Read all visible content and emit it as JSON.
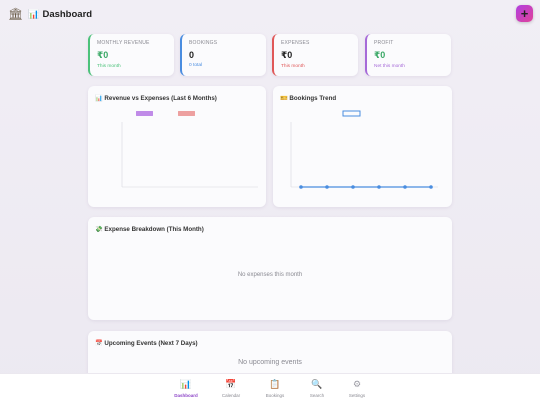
{
  "header": {
    "brand_icon": "bank-icon",
    "title_icon": "bar-chart-icon",
    "title": "Dashboard",
    "add_label": "+"
  },
  "stats": [
    {
      "label": "MONTHLY REVENUE",
      "value": "₹0",
      "sub": "This month",
      "color": "#4cc27a"
    },
    {
      "label": "BOOKINGS",
      "value": "0",
      "sub": "0 total",
      "color": "#4a8de0"
    },
    {
      "label": "EXPENSES",
      "value": "₹0",
      "sub": "This month",
      "color": "#e05858"
    },
    {
      "label": "PROFIT",
      "value": "₹0",
      "sub": "Net this month",
      "color": "#a66ad8"
    }
  ],
  "revenue_chart": {
    "title": "📊 Revenue vs Expenses (Last 6 Months)"
  },
  "bookings_chart": {
    "title": "🎫 Bookings Trend"
  },
  "breakdown": {
    "title": "💸 Expense Breakdown (This Month)",
    "empty": "No expenses this month"
  },
  "events": {
    "title": "📅 Upcoming Events (Next 7 Days)",
    "empty": "No upcoming events"
  },
  "nav": [
    {
      "icon": "chart-icon",
      "label": "Dashboard",
      "active": true
    },
    {
      "icon": "calendar-icon",
      "label": "Calendar",
      "active": false
    },
    {
      "icon": "clipboard-icon",
      "label": "Bookings",
      "active": false
    },
    {
      "icon": "search-icon",
      "label": "Search",
      "active": false
    },
    {
      "icon": "gear-icon",
      "label": "Settings",
      "active": false
    }
  ],
  "chart_data": [
    {
      "type": "bar",
      "title": "📊 Revenue vs Expenses (Last 6 Months)",
      "series": [
        {
          "values": [],
          "color": "#c08be8"
        },
        {
          "values": [],
          "color": "#eda0a0"
        }
      ],
      "categories": [],
      "grid": false,
      "legend": "top"
    },
    {
      "type": "line",
      "title": "🎫 Bookings Trend",
      "x": [
        1,
        2,
        3,
        4,
        5,
        6
      ],
      "series": [
        {
          "values": [
            0,
            0,
            0,
            0,
            0,
            0
          ],
          "color": "#4a8de0"
        }
      ],
      "grid": false,
      "legend": "top"
    }
  ]
}
